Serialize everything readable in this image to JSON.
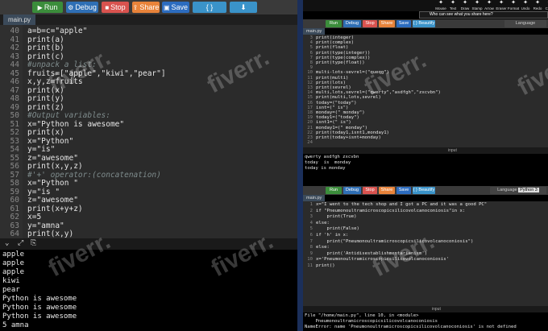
{
  "left": {
    "toolbar": {
      "run": "Run",
      "debug": "Debug",
      "stop": "Stop",
      "share": "Share",
      "save": "Save",
      "beautify": "{ } Beautify"
    },
    "tab": "main.py",
    "lines": [
      {
        "n": "40",
        "t": "a=b=c=\"apple\""
      },
      {
        "n": "41",
        "t": "print(a)"
      },
      {
        "n": "42",
        "t": "print(b)"
      },
      {
        "n": "43",
        "t": "print(c)"
      },
      {
        "n": "44",
        "t": "#unpack a list:"
      },
      {
        "n": "45",
        "t": "fruits=[\"apple\",\"kiwi\",\"pear\"]"
      },
      {
        "n": "46",
        "t": "x,y,z=fruits"
      },
      {
        "n": "47",
        "t": "print(x)"
      },
      {
        "n": "48",
        "t": "print(y)"
      },
      {
        "n": "49",
        "t": "print(z)"
      },
      {
        "n": "50",
        "t": "#Output variables:"
      },
      {
        "n": "51",
        "t": "x=\"Python is awesome\""
      },
      {
        "n": "52",
        "t": "print(x)"
      },
      {
        "n": "53",
        "t": "x=\"Python\""
      },
      {
        "n": "54",
        "t": "y=\"is\""
      },
      {
        "n": "55",
        "t": "z=\"awesome\""
      },
      {
        "n": "56",
        "t": "print(x,y,z)"
      },
      {
        "n": "57",
        "t": "#'+' operator:(concatenation)"
      },
      {
        "n": "58",
        "t": "x=\"Python \""
      },
      {
        "n": "59",
        "t": "y=\"is \""
      },
      {
        "n": "60",
        "t": "z=\"awesome\""
      },
      {
        "n": "61",
        "t": "print(x+y+z)"
      },
      {
        "n": "62",
        "t": "x=5"
      },
      {
        "n": "63",
        "t": "y=\"amna\""
      },
      {
        "n": "64",
        "t": "print(x,y)"
      }
    ],
    "output": [
      "apple",
      "apple",
      "apple",
      "kiwi",
      "pear",
      "Python is awesome",
      "Python is awesome",
      "Python is awesome",
      "5 amna"
    ]
  },
  "right": {
    "tools": [
      {
        "name": "Mouse"
      },
      {
        "name": "Text"
      },
      {
        "name": "Draw"
      },
      {
        "name": "Stamp"
      },
      {
        "name": "Arrow"
      },
      {
        "name": "Eraser"
      },
      {
        "name": "Format"
      },
      {
        "name": "Undo"
      },
      {
        "name": "Redo"
      },
      {
        "name": "Clear"
      }
    ],
    "share_prompt": "Who can see what you share here?",
    "language_label": "Language",
    "language_value": "Python 3",
    "top": {
      "toolbar": {
        "run": "Run",
        "debug": "Debug",
        "stop": "Stop",
        "share": "Share",
        "save": "Save",
        "beautify": "{ } Beautify"
      },
      "tab": "main.py",
      "lines": [
        {
          "n": "3",
          "t": "print(integer)"
        },
        {
          "n": "4",
          "t": "print(complex)"
        },
        {
          "n": "5",
          "t": "print(float)"
        },
        {
          "n": "6",
          "t": "print(type(integer))"
        },
        {
          "n": "7",
          "t": "print(type(complex))"
        },
        {
          "n": "8",
          "t": "print(type(float))"
        },
        {
          "n": "9",
          "t": ""
        },
        {
          "n": "10",
          "t": "multi-lots-sevrel=(\"queqg\")"
        },
        {
          "n": "11",
          "t": "print(multi)"
        },
        {
          "n": "12",
          "t": "print(lots)"
        },
        {
          "n": "13",
          "t": "print(sevrel)"
        },
        {
          "n": "14",
          "t": "multi,lots,sevrel=(\"qwerty\",\"asdfgh\",\"zxcvbn\")"
        },
        {
          "n": "15",
          "t": "print(multi,lots,sevrel)"
        },
        {
          "n": "16",
          "t": "today=(\"today\")"
        },
        {
          "n": "17",
          "t": "isnt=(\" is\")"
        },
        {
          "n": "18",
          "t": "monday=(\" monday\")"
        },
        {
          "n": "19",
          "t": "today1=(\"today\")"
        },
        {
          "n": "20",
          "t": "isnt1=(\" is\")"
        },
        {
          "n": "21",
          "t": "monday1=(\" monday\")"
        },
        {
          "n": "22",
          "t": "print(today1,isnt1,monday1)"
        },
        {
          "n": "23",
          "t": "print(today+isnt+monday)"
        },
        {
          "n": "24",
          "t": ""
        }
      ],
      "input_label": "input",
      "output": [
        "qwerty asdfgh zxcvbn",
        "today  is  monday",
        "today is monday"
      ]
    },
    "bottom": {
      "toolbar": {
        "run": "Run",
        "debug": "Debug",
        "stop": "Stop",
        "share": "Share",
        "save": "Save",
        "beautify": "{ } Beautify"
      },
      "tab": "main.py",
      "lines": [
        {
          "n": "1",
          "t": "x=\"I went to the tech shop and I got a PC and it was a good PC\""
        },
        {
          "n": "2",
          "t": "if \"Pneumonoultramicroscopicsilicovolcanoconiosis\"in x:"
        },
        {
          "n": "3",
          "t": "    print(True)"
        },
        {
          "n": "4",
          "t": "else:"
        },
        {
          "n": "5",
          "t": "    print(False)"
        },
        {
          "n": "6",
          "t": "if 'h' in x:"
        },
        {
          "n": "7",
          "t": "    print(\"Pneumonoultramicroscopicsilicovolcanoconiosis\")"
        },
        {
          "n": "8",
          "t": "else:"
        },
        {
          "n": "9",
          "t": "    print('Antidisestablishmentarianism')"
        },
        {
          "n": "10",
          "t": "x='Pneumonoultramicroscopicsilicovolcanoconiosis'"
        },
        {
          "n": "11",
          "t": "print()"
        }
      ],
      "input_label": "input",
      "output": [
        "File \"/home/main.py\", line 10, in <module>",
        "    Pneumonoultramicroscopicsilicovolcanoconiosis",
        "NameError: name 'Pneumonoultramicroscopicsilicovolcanoconiosis' is not defined"
      ]
    }
  },
  "watermark": "fiverr.",
  "colors": {
    "run": "#3b8d3b",
    "debug": "#2f6fb5",
    "stop": "#d9534f",
    "share": "#e8833a",
    "save": "#2c6cbf",
    "beautify": "#3a93c9"
  }
}
